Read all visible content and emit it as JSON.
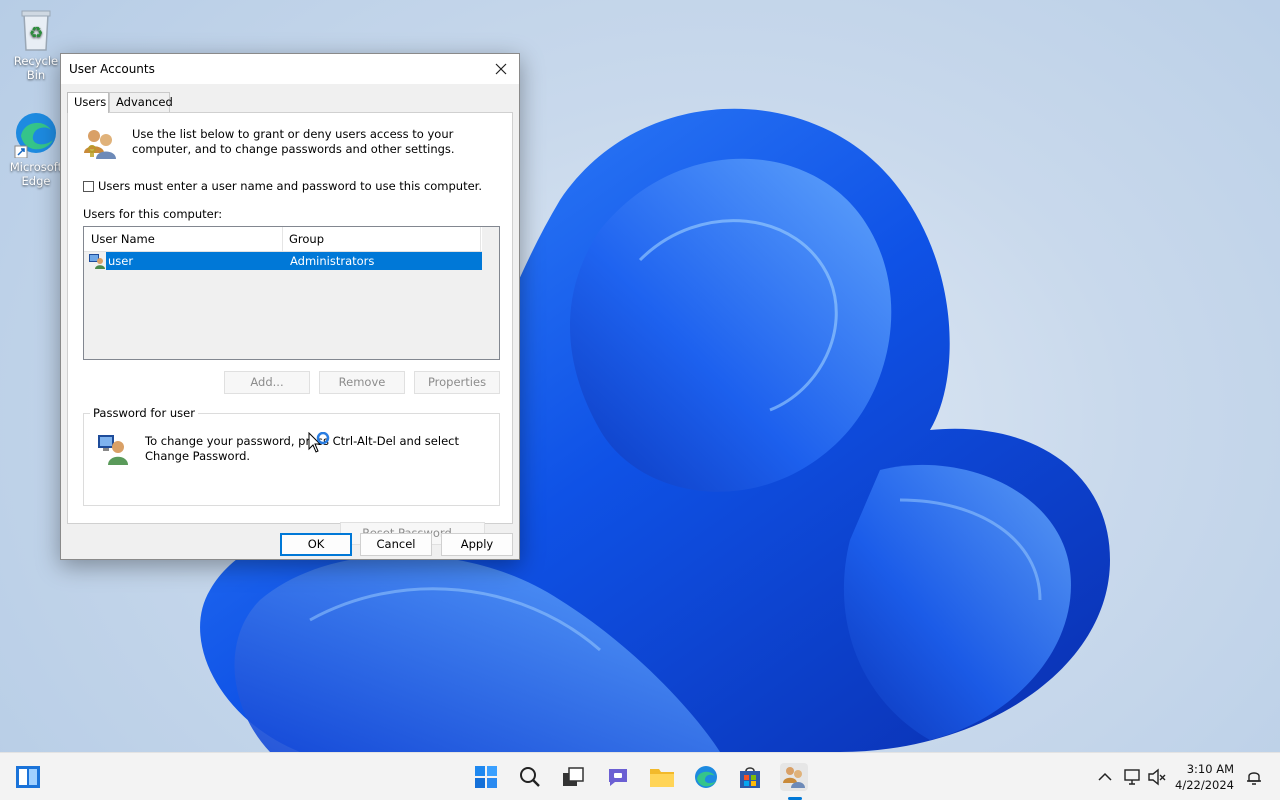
{
  "desktop": {
    "icons": [
      {
        "label": "Recycle Bin"
      },
      {
        "label": "Microsoft Edge"
      }
    ]
  },
  "dialog": {
    "title": "User Accounts",
    "tabs": [
      {
        "label": "Users",
        "active": true
      },
      {
        "label": "Advanced",
        "active": false
      }
    ],
    "intro_text": "Use the list below to grant or deny users access to your computer, and to change passwords and other settings.",
    "require_login": {
      "label": "Users must enter a user name and password to use this computer.",
      "checked": false
    },
    "users_caption": "Users for this computer:",
    "table": {
      "columns": [
        "User Name",
        "Group"
      ],
      "rows": [
        {
          "user_name": "user",
          "group": "Administrators",
          "selected": true
        }
      ]
    },
    "list_buttons": {
      "add": "Add...",
      "remove": "Remove",
      "properties": "Properties"
    },
    "password_group": {
      "legend": "Password for user",
      "text": "To change your password, press Ctrl-Alt-Del and select Change Password.",
      "reset_button": "Reset Password..."
    },
    "footer": {
      "ok": "OK",
      "cancel": "Cancel",
      "apply": "Apply"
    }
  },
  "taskbar": {
    "time": "3:10 AM",
    "date": "4/22/2024",
    "accent": "#0078d7"
  }
}
